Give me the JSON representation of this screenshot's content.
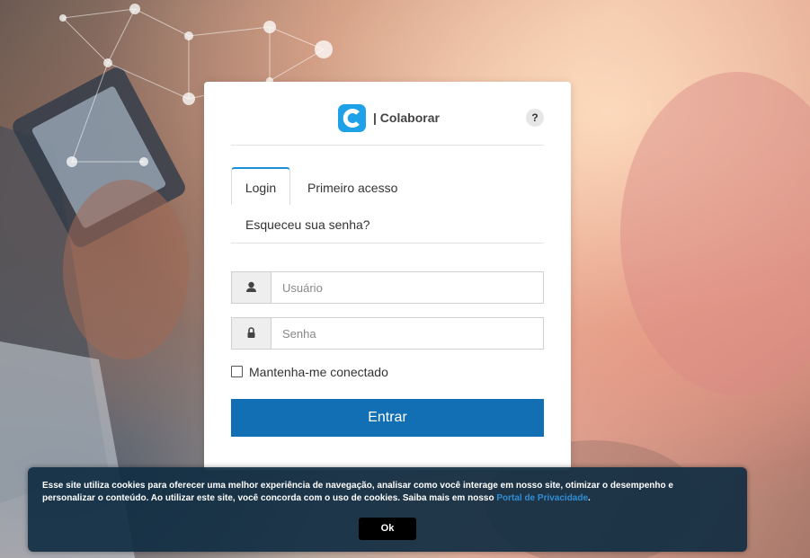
{
  "login_card": {
    "app_name": "| Colaborar",
    "help_label": "?",
    "tabs": [
      {
        "label": "Login"
      },
      {
        "label": "Primeiro acesso"
      }
    ],
    "forgot_password": "Esqueceu sua senha?",
    "username_placeholder": "Usuário",
    "password_placeholder": "Senha",
    "remember_label": "Mantenha-me conectado",
    "submit_label": "Entrar"
  },
  "cookie_banner": {
    "text": "Esse site utiliza cookies para oferecer uma melhor experiência de navegação, analisar como você interage em nosso site, otimizar o desempenho e personalizar o conteúdo. Ao utilizar este site, você concorda com o uso de cookies. Saiba mais em nosso ",
    "link_label": "Portal de Privacidade",
    "text_end": ".",
    "ok_label": "Ok"
  },
  "colors": {
    "brand": "#1ea1e6",
    "primary_button": "#136fb3",
    "cookie_background": "#102c42",
    "link": "#2f8fd6"
  },
  "icons": [
    "colaborar-logo-icon",
    "user-icon",
    "lock-icon"
  ]
}
